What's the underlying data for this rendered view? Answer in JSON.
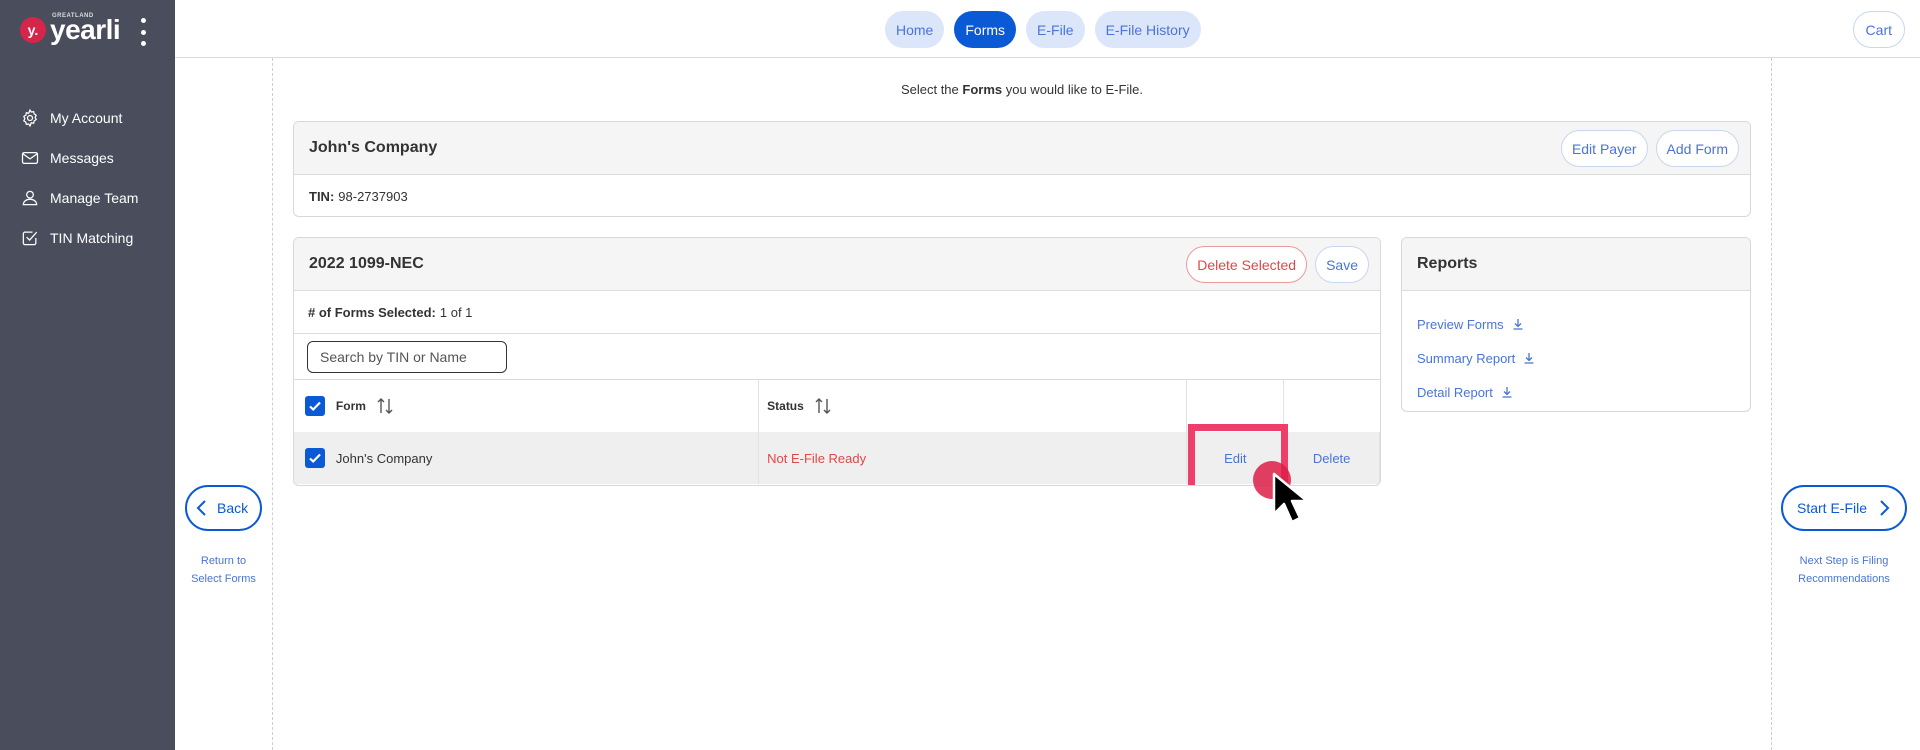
{
  "sidebar": {
    "logo": {
      "badge": "y.",
      "small": "GREATLAND",
      "word": "yearli"
    },
    "items": [
      {
        "label": "My Account",
        "icon": "gear-icon"
      },
      {
        "label": "Messages",
        "icon": "envelope-icon"
      },
      {
        "label": "Manage Team",
        "icon": "user-icon"
      },
      {
        "label": "TIN Matching",
        "icon": "check-square-icon"
      }
    ]
  },
  "topbar": {
    "tabs": [
      {
        "label": "Home",
        "active": false
      },
      {
        "label": "Forms",
        "active": true
      },
      {
        "label": "E-File",
        "active": false
      },
      {
        "label": "E-File History",
        "active": false
      }
    ],
    "cart_label": "Cart"
  },
  "instruction": {
    "prefix": "Select the ",
    "bold": "Forms",
    "suffix": " you would like to E-File."
  },
  "payer": {
    "name": "John's Company",
    "edit_label": "Edit Payer",
    "add_label": "Add Form",
    "tin_label": "TIN:",
    "tin_value": "98-2737903"
  },
  "forms": {
    "title": "2022 1099-NEC",
    "delete_selected_label": "Delete Selected",
    "save_label": "Save",
    "selected_label": "# of Forms Selected:",
    "selected_value": "1 of 1",
    "search_placeholder": "Search by TIN or Name",
    "columns": {
      "form": "Form",
      "status": "Status"
    },
    "rows": [
      {
        "name": "John's Company",
        "status": "Not E-File Ready",
        "edit": "Edit",
        "delete": "Delete",
        "checked": true
      }
    ]
  },
  "reports": {
    "title": "Reports",
    "links": [
      "Preview Forms",
      "Summary Report",
      "Detail Report"
    ]
  },
  "navigation": {
    "back_label": "Back",
    "back_note_1": "Return to",
    "back_note_2": "Select Forms",
    "next_label": "Start E-File",
    "next_note_1": "Next Step is Filing",
    "next_note_2": "Recommendations"
  },
  "colors": {
    "accent": "#0a5ad6",
    "sidebar": "#4a4e5c",
    "danger": "#e04848",
    "highlight": "#ee3e6a"
  }
}
